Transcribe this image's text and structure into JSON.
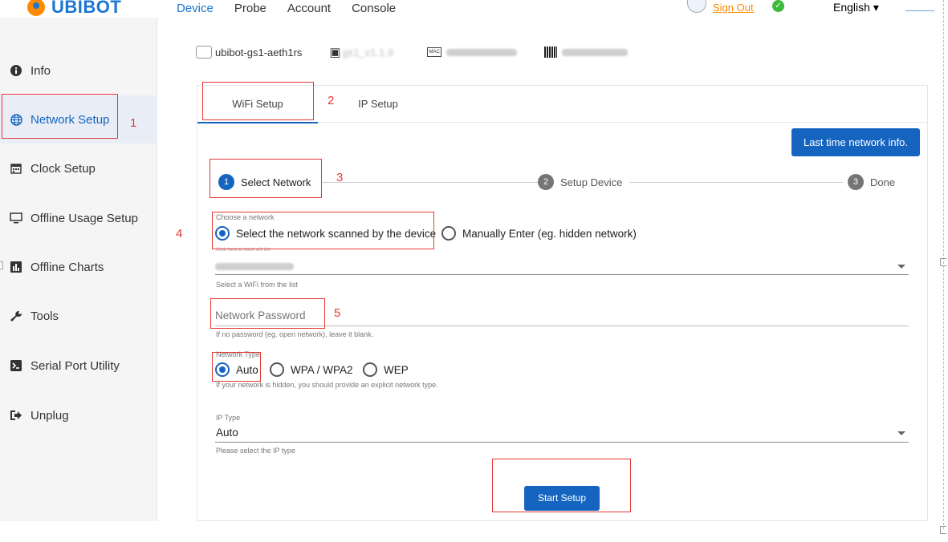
{
  "header": {
    "brand": "UBIBOT",
    "nav": [
      "Device",
      "Probe",
      "Account",
      "Console"
    ],
    "active_nav": "Device",
    "sign_out": "Sign Out",
    "language": "English"
  },
  "sidebar": {
    "items": [
      {
        "label": "Info",
        "icon": "info-icon"
      },
      {
        "label": "Network Setup",
        "icon": "globe-icon",
        "active": true
      },
      {
        "label": "Clock Setup",
        "icon": "calendar-icon"
      },
      {
        "label": "Offline Usage Setup",
        "icon": "monitor-icon"
      },
      {
        "label": "Offline Charts",
        "icon": "bar-chart-icon"
      },
      {
        "label": "Tools",
        "icon": "wrench-icon"
      },
      {
        "label": "Serial Port Utility",
        "icon": "terminal-icon"
      },
      {
        "label": "Unplug",
        "icon": "sign-out-icon"
      }
    ]
  },
  "device": {
    "name": "ubibot-gs1-aeth1rs",
    "firmware": "gs1_v1.1.9"
  },
  "tabs": [
    "WiFi Setup",
    "IP Setup"
  ],
  "last_network_button": "Last time network info.",
  "stepper": [
    {
      "num": "1",
      "label": "Select Network"
    },
    {
      "num": "2",
      "label": "Setup Device"
    },
    {
      "num": "3",
      "label": "Done"
    }
  ],
  "network": {
    "choose_label": "Choose a network",
    "option_scanned": "Select the network scanned by the device",
    "option_manual": "Manually Enter (eg. hidden network)",
    "fetch_hint": "Click here to fetch wifi list",
    "wifi_helper": "Select a WiFi from the list"
  },
  "password": {
    "placeholder": "Network Password",
    "helper": "If no password (eg. open network), leave it blank."
  },
  "network_type": {
    "label": "Network Type",
    "options": [
      "Auto",
      "WPA / WPA2",
      "WEP"
    ],
    "helper": "If your network is hidden, you should provide an explicit network type."
  },
  "ip_type": {
    "label": "IP Type",
    "value": "Auto",
    "helper": "Please select the IP type"
  },
  "start_button": "Start Setup",
  "annotations": [
    "1",
    "2",
    "3",
    "4",
    "5"
  ],
  "colors": {
    "primary": "#1565c0",
    "annotation_red": "#e53935",
    "brand_orange": "#ff8a00"
  }
}
